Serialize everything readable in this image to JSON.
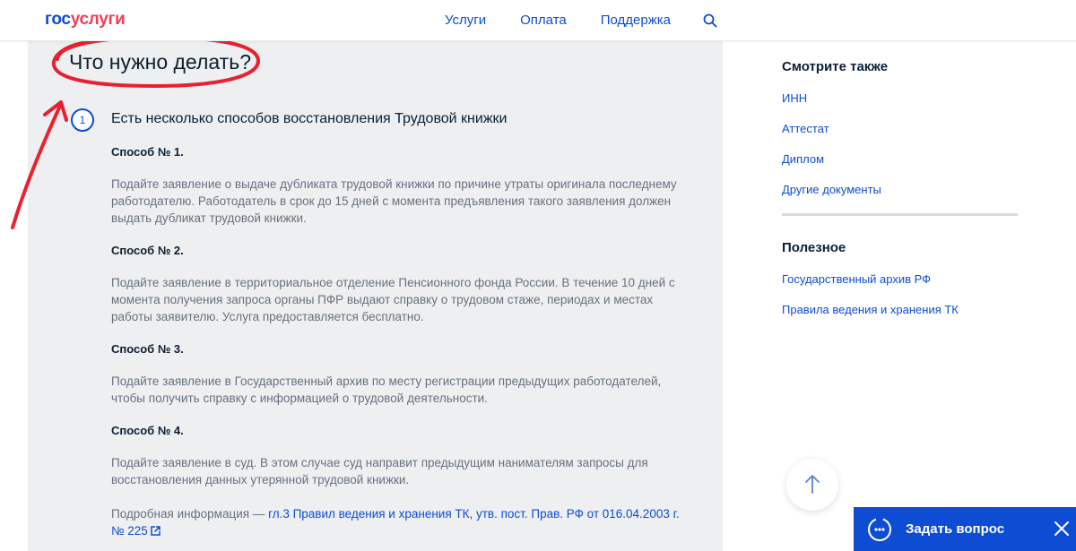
{
  "header": {
    "logo_part1": "гос",
    "logo_part2": "услуги",
    "nav": [
      "Услуги",
      "Оплата",
      "Поддержка"
    ]
  },
  "main": {
    "title": "Что нужно делать?",
    "step_number": "1",
    "step_title": "Есть несколько способов восстановления Трудовой книжки",
    "methods": [
      {
        "head": "Способ № 1.",
        "text": "Подайте заявление о выдаче дубликата трудовой книжки по причине утраты оригинала последнему работодателю. Работодатель в срок до 15 дней с момента предъявления такого заявления должен выдать дубликат трудовой книжки."
      },
      {
        "head": "Способ № 2.",
        "text": "Подайте заявление в территориальное отделение Пенсионного фонда России. В течение 10 дней с момента получения запроса органы ПФР выдают справку о трудовом стаже, периодах и местах работы заявителю. Услуга предоставляется бесплатно."
      },
      {
        "head": "Способ № 3.",
        "text": "Подайте заявление в Государственный архив по месту регистрации предыдущих работодателей, чтобы получить справку с информацией о трудовой деятельности."
      },
      {
        "head": "Способ № 4.",
        "text": "Подайте заявление в суд. В этом случае суд направит предыдущим нанимателям запросы для восстановления данных утерянной трудовой книжки."
      }
    ],
    "more_info_prefix": "Подробная информация — ",
    "more_info_link": "гл.3 Правил ведения и хранения ТК, утв. пост. Прав. РФ от 016.04.2003 г. № 225"
  },
  "sidebar": {
    "see_also_head": "Смотрите также",
    "see_also_links": [
      "ИНН",
      "Аттестат",
      "Диплом",
      "Другие документы"
    ],
    "useful_head": "Полезное",
    "useful_links": [
      "Государственный архив РФ",
      "Правила ведения и хранения ТК"
    ]
  },
  "ask_widget": {
    "label": "Задать вопрос"
  },
  "colors": {
    "brand_blue": "#0d4cd3",
    "brand_red": "#ee3f58",
    "annotation_red": "#e8202f",
    "panel_grey": "#eeeff1"
  }
}
